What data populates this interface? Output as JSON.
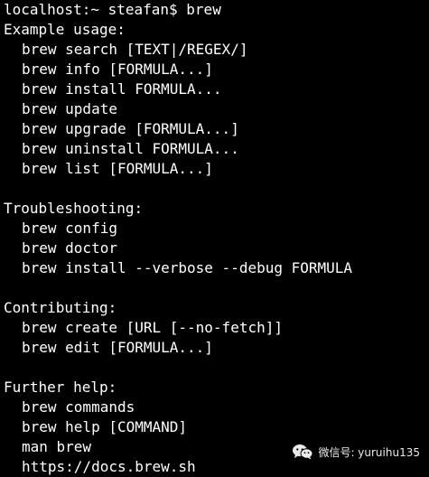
{
  "terminal": {
    "prompt_line": "localhost:~ steafan$ brew",
    "sections": [
      {
        "heading": "Example usage:",
        "lines": [
          "brew search [TEXT|/REGEX/]",
          "brew info [FORMULA...]",
          "brew install FORMULA...",
          "brew update",
          "brew upgrade [FORMULA...]",
          "brew uninstall FORMULA...",
          "brew list [FORMULA...]"
        ]
      },
      {
        "heading": "Troubleshooting:",
        "lines": [
          "brew config",
          "brew doctor",
          "brew install --verbose --debug FORMULA"
        ]
      },
      {
        "heading": "Contributing:",
        "lines": [
          "brew create [URL [--no-fetch]]",
          "brew edit [FORMULA...]"
        ]
      },
      {
        "heading": "Further help:",
        "lines": [
          "brew commands",
          "brew help [COMMAND]",
          "man brew",
          "https://docs.brew.sh"
        ]
      }
    ]
  },
  "watermark": {
    "text": "微信号: yuruihu135",
    "icon": "wechat-icon"
  },
  "colors": {
    "background": "#000000",
    "text": "#ffffff"
  }
}
